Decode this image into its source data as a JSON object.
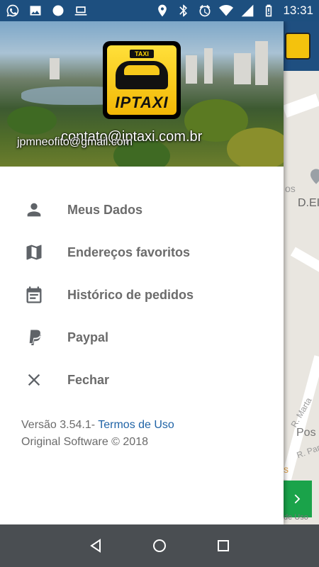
{
  "status_bar": {
    "time": "13:31",
    "left_icons": [
      "whatsapp-icon",
      "image-icon",
      "app-icon",
      "laptop-icon"
    ],
    "right_icons": [
      "location-icon",
      "bluetooth-icon",
      "alarm-icon",
      "wifi-icon",
      "signal-icon",
      "battery-icon"
    ]
  },
  "drawer": {
    "header": {
      "logo_badge": "TAXI",
      "logo_text": "IPTAXI",
      "contact_email": "contato@iptaxi.com.br",
      "user_email": "jpmneofito@gmail.com"
    },
    "menu": [
      {
        "label": "Meus Dados",
        "icon": "person-icon"
      },
      {
        "label": "Endereços favoritos",
        "icon": "map-icon"
      },
      {
        "label": "Histórico de pedidos",
        "icon": "calendar-icon"
      },
      {
        "label": "Paypal",
        "icon": "paypal-icon"
      },
      {
        "label": "Fechar",
        "icon": "close-icon"
      }
    ],
    "footer": {
      "version": "Versão 3.54.1-",
      "terms_link": "Termos de Uso",
      "copyright": "Original Software © 2018"
    }
  },
  "map_labels": {
    "label1": "os",
    "label2": "D.EI",
    "label3": "R. Marta",
    "label4": "Pos",
    "label5": "R. Par",
    "label6": "s",
    "label7": "de Uso"
  },
  "colors": {
    "status_bar": "#1d4f7f",
    "nav_bar": "#4a4e52",
    "link": "#1f63a6",
    "menu_text": "#6b6b6b",
    "icon": "#5f6368",
    "logo_yellow": "#f2b705",
    "green_button": "#1aa34a"
  }
}
